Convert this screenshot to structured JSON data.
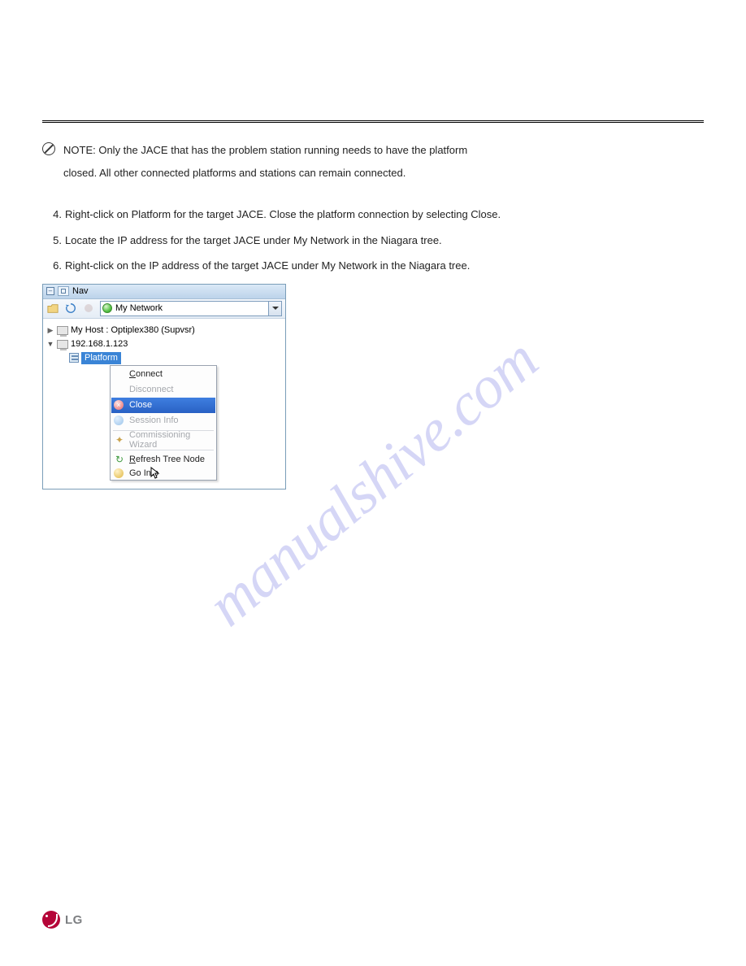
{
  "note": {
    "line1": "NOTE: Only the JACE that has the problem station running needs to have the platform",
    "line2": "closed. All other connected platforms and stations can remain connected."
  },
  "steps": {
    "s4_prefix": "4. ",
    "s4_text": "Right-click on Platform for the target JACE. Close the platform connection by selecting Close.",
    "s5_prefix": "5. ",
    "s5_text": "Locate the IP address for the target JACE under My Network in the Niagara tree.",
    "s6_prefix": "6. ",
    "s6_text": "Right-click on the IP address of the target JACE under My Network in the Niagara tree."
  },
  "nav": {
    "title": "Nav",
    "combo": "My Network",
    "tree": {
      "host_label": "My Host : Optiplex380 (Supvsr)",
      "ip_label": "192.168.1.123",
      "platform_label": "Platform"
    }
  },
  "menu": {
    "connect": "Connect",
    "disconnect": "Disconnect",
    "close": "Close",
    "session_info": "Session Info",
    "commissioning": "Commissioning Wizard",
    "refresh_tree": "Refresh Tree Node",
    "go_into": "Go Into"
  },
  "watermark": "manualshive.com",
  "logo_text": "LG"
}
